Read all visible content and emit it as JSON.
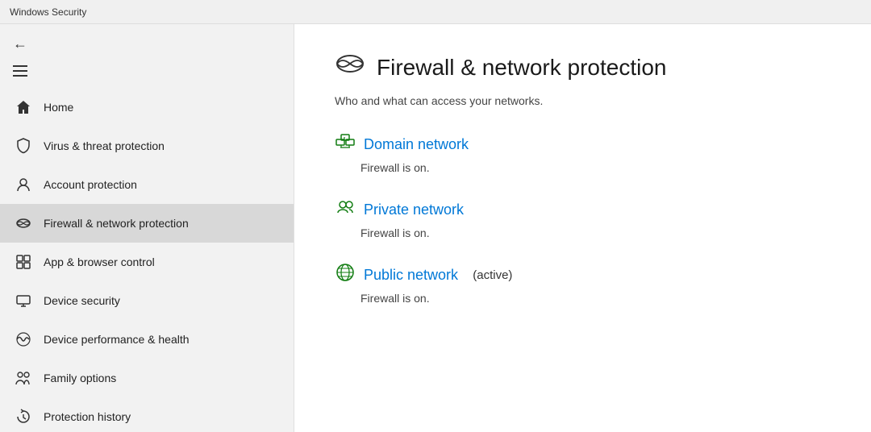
{
  "titleBar": {
    "label": "Windows Security"
  },
  "sidebar": {
    "backButton": "←",
    "menuButton": "menu",
    "navItems": [
      {
        "id": "home",
        "icon": "🏠",
        "label": "Home",
        "active": false
      },
      {
        "id": "virus",
        "icon": "🛡",
        "label": "Virus & threat protection",
        "active": false
      },
      {
        "id": "account",
        "icon": "👤",
        "label": "Account protection",
        "active": false
      },
      {
        "id": "firewall",
        "icon": "📶",
        "label": "Firewall & network protection",
        "active": true
      },
      {
        "id": "app",
        "icon": "⬜",
        "label": "App & browser control",
        "active": false
      },
      {
        "id": "device",
        "icon": "💻",
        "label": "Device security",
        "active": false
      },
      {
        "id": "perf",
        "icon": "❤",
        "label": "Device performance & health",
        "active": false
      },
      {
        "id": "family",
        "icon": "👨‍👩‍👧",
        "label": "Family options",
        "active": false
      },
      {
        "id": "history",
        "icon": "🔄",
        "label": "Protection history",
        "active": false
      }
    ]
  },
  "content": {
    "pageIcon": "📶",
    "pageTitle": "Firewall & network protection",
    "pageSubtitle": "Who and what can access your networks.",
    "networks": [
      {
        "id": "domain",
        "icon": "🏢",
        "name": "Domain network",
        "active": false,
        "activeLabel": "",
        "status": "Firewall is on."
      },
      {
        "id": "private",
        "icon": "👥",
        "name": "Private network",
        "active": false,
        "activeLabel": "",
        "status": "Firewall is on."
      },
      {
        "id": "public",
        "icon": "🌐",
        "name": "Public network",
        "active": true,
        "activeLabel": " (active)",
        "status": "Firewall is on."
      }
    ]
  }
}
